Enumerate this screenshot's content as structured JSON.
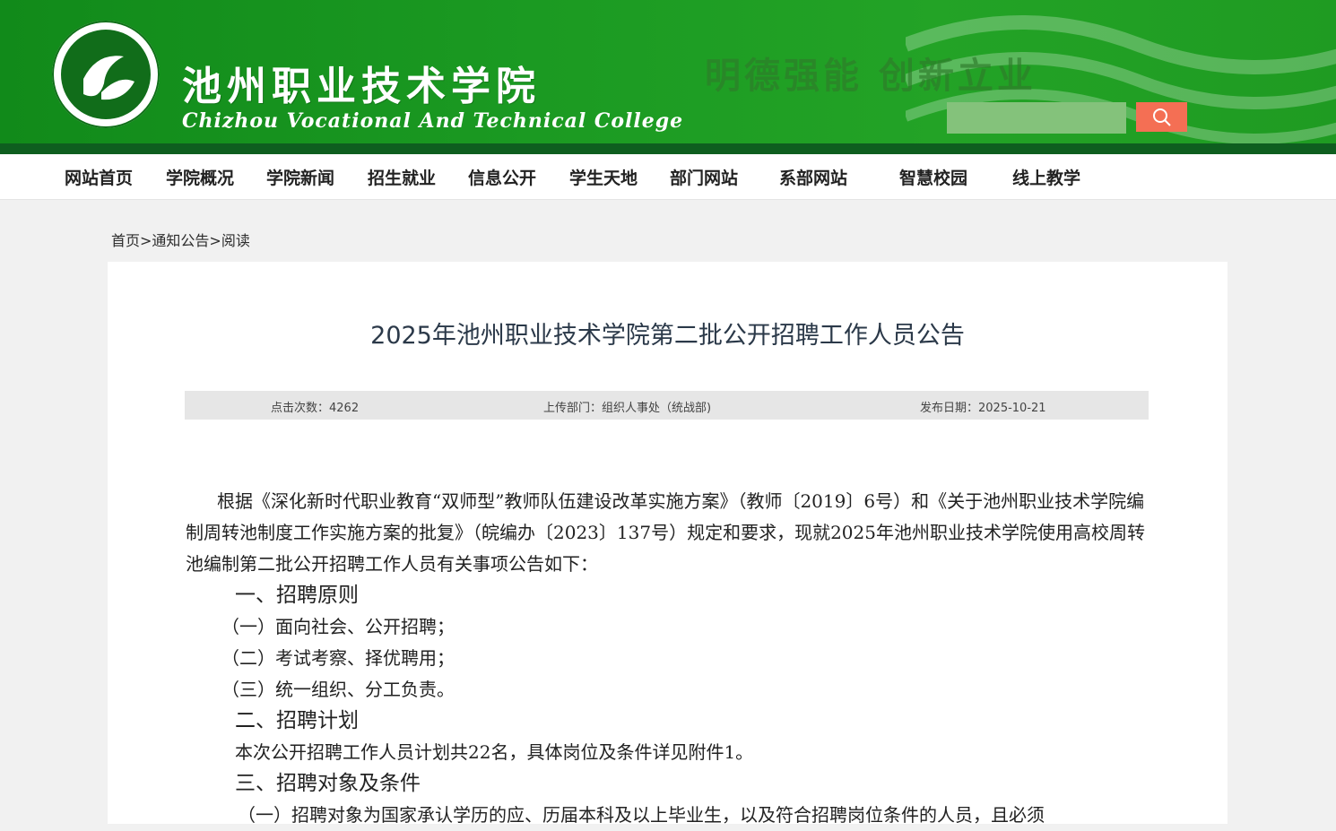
{
  "header": {
    "school_name_cn": "池州职业技术学院",
    "school_name_en": "Chizhou Vocational And Technical College",
    "motto": "明德强能 创新立业",
    "search": {
      "placeholder": "",
      "button_icon": "search-icon"
    },
    "colors": {
      "green": "#1b9a22",
      "dark_band": "#0e5e1f",
      "search_btn": "#f46f54"
    }
  },
  "nav": {
    "items": [
      {
        "label": "网站首页"
      },
      {
        "label": "学院概况"
      },
      {
        "label": "学院新闻"
      },
      {
        "label": "招生就业"
      },
      {
        "label": "信息公开"
      },
      {
        "label": "学生天地"
      },
      {
        "label": "部门网站"
      },
      {
        "label": "系部网站"
      },
      {
        "label": "智慧校园"
      },
      {
        "label": "线上教学"
      }
    ]
  },
  "breadcrumb": {
    "text": "首页>通知公告>阅读"
  },
  "article": {
    "title": "2025年池州职业技术学院第二批公开招聘工作人员公告",
    "meta": {
      "views": "点击次数：4262",
      "dept": "上传部门：组织人事处（统战部)",
      "date": "发布日期：2025-10-21"
    },
    "intro": "根据《深化新时代职业教育“双师型”教师队伍建设改革实施方案》（教师〔2019〕6号）和《关于池州职业技术学院编制周转池制度工作实施方案的批复》（皖编办〔2023〕137号）规定和要求，现就2025年池州职业技术学院使用高校周转池编制第二批公开招聘工作人员有关事项公告如下：",
    "section1": "一、招聘原则",
    "s1_items": [
      "（一）面向社会、公开招聘；",
      "（二）考试考察、择优聘用；",
      "（三）统一组织、分工负责。"
    ],
    "section2": "二、招聘计划",
    "s2_text": "本次公开招聘工作人员计划共22名，具体岗位及条件详见附件1。",
    "section3": "三、招聘对象及条件",
    "s3_text": "（一）招聘对象为国家承认学历的应、历届本科及以上毕业生，以及符合招聘岗位条件的人员，且必须"
  }
}
